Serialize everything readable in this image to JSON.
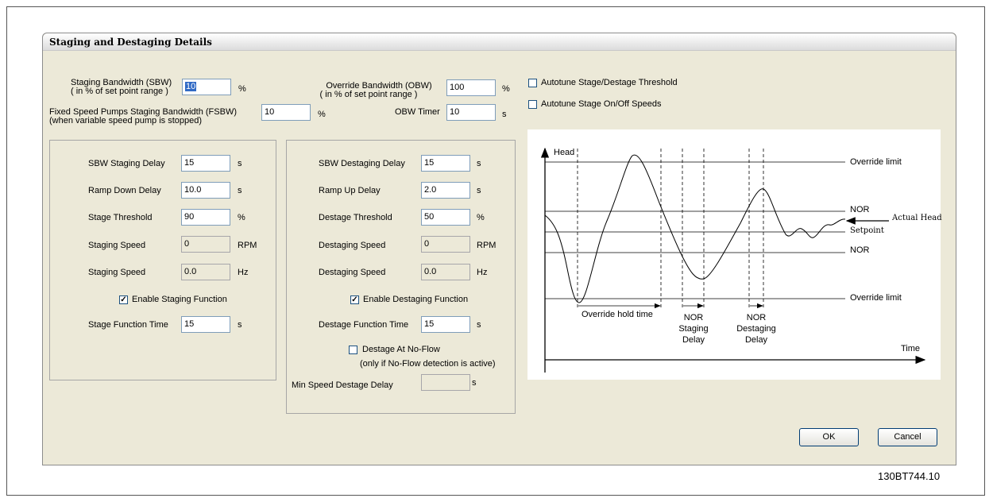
{
  "window": {
    "title": "Staging and Destaging Details"
  },
  "top": {
    "sbw_label1": "Staging Bandwidth (SBW)",
    "sbw_label2": "( in % of set point range )",
    "sbw_value": "10",
    "sbw_unit": "%",
    "obw_label1": "Override Bandwidth (OBW)",
    "obw_label2": "( in % of set point range )",
    "obw_value": "100",
    "obw_unit": "%",
    "fsbw_label1": "Fixed Speed Pumps Staging Bandwidth (FSBW)",
    "fsbw_label2": "(when variable speed pump is stopped)",
    "fsbw_value": "10",
    "fsbw_unit": "%",
    "obw_timer_label": "OBW Timer",
    "obw_timer_value": "10",
    "obw_timer_unit": "s",
    "autotune_threshold_label": "Autotune Stage/Destage Threshold",
    "autotune_threshold_checked": false,
    "autotune_speeds_label": "Autotune Stage On/Off Speeds",
    "autotune_speeds_checked": false
  },
  "staging": {
    "sbw_delay_label": "SBW Staging Delay",
    "sbw_delay_value": "15",
    "sbw_delay_unit": "s",
    "ramp_down_label": "Ramp Down Delay",
    "ramp_down_value": "10.0",
    "ramp_down_unit": "s",
    "threshold_label": "Stage Threshold",
    "threshold_value": "90",
    "threshold_unit": "%",
    "speed_rpm_label": "Staging Speed",
    "speed_rpm_value": "0",
    "speed_rpm_unit": "RPM",
    "speed_hz_label": "Staging Speed",
    "speed_hz_value": "0.0",
    "speed_hz_unit": "Hz",
    "enable_label": "Enable Staging Function",
    "enable_checked": true,
    "function_time_label": "Stage Function Time",
    "function_time_value": "15",
    "function_time_unit": "s"
  },
  "destaging": {
    "sbw_delay_label": "SBW Destaging Delay",
    "sbw_delay_value": "15",
    "sbw_delay_unit": "s",
    "ramp_up_label": "Ramp Up Delay",
    "ramp_up_value": "2.0",
    "ramp_up_unit": "s",
    "threshold_label": "Destage Threshold",
    "threshold_value": "50",
    "threshold_unit": "%",
    "speed_rpm_label": "Destaging Speed",
    "speed_rpm_value": "0",
    "speed_rpm_unit": "RPM",
    "speed_hz_label": "Destaging Speed",
    "speed_hz_value": "0.0",
    "speed_hz_unit": "Hz",
    "enable_label": "Enable Destaging Function",
    "enable_checked": true,
    "function_time_label": "Destage Function Time",
    "function_time_value": "15",
    "function_time_unit": "s",
    "noflow_label": "Destage At No-Flow",
    "noflow_checked": false,
    "noflow_note": "(only if No-Flow detection is active)",
    "min_speed_label": "Min Speed Destage Delay",
    "min_speed_value": "",
    "min_speed_unit": "s"
  },
  "diagram": {
    "head": "Head",
    "time": "Time",
    "override_limit_top": "Override limit",
    "nor_top": "NOR",
    "actual_head": "Actual Head",
    "setpoint": "Setpoint",
    "nor_bottom": "NOR",
    "override_limit_bottom": "Override limit",
    "override_hold_time": "Override hold time",
    "staging_delay_1": "NOR",
    "staging_delay_2": "Staging",
    "staging_delay_3": "Delay",
    "destaging_delay_1": "NOR",
    "destaging_delay_2": "Destaging",
    "destaging_delay_3": "Delay"
  },
  "buttons": {
    "ok": "OK",
    "cancel": "Cancel"
  },
  "figure_id": "130BT744.10",
  "colors": {
    "window_bg": "#ece9d8",
    "input_border": "#7f9db9",
    "selection": "#316ac5"
  }
}
